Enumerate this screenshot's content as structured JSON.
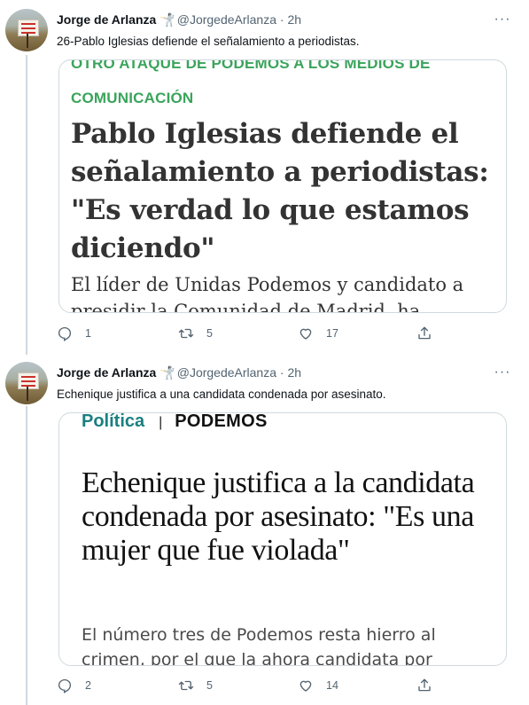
{
  "tweets": [
    {
      "author": {
        "name": "Jorge de Arlanza",
        "badge": "🤺",
        "handle": "@JorgedeArlanza",
        "time": "2h",
        "avatar_sign_text": "PROHIBIDO EL PASO A TODA PERSONA AJENA"
      },
      "text": "26-Pablo Iglesias defiende el señalamiento a periodistas.",
      "card": {
        "kicker_line1": "OTRO ATAQUE DE PODEMOS A LOS MEDIOS DE",
        "kicker_line2": "COMUNICACIÓN",
        "headline": "Pablo Iglesias defiende el señalamiento a periodistas: \"Es verdad lo que estamos diciendo\"",
        "lead_line1": "El líder de Unidas Podemos y candidato a",
        "lead_line2": "presidir la Comunidad de Madrid, ha"
      },
      "stats": {
        "replies": "1",
        "retweets": "5",
        "likes": "17"
      }
    },
    {
      "author": {
        "name": "Jorge de Arlanza",
        "badge": "🤺",
        "handle": "@JorgedeArlanza",
        "time": "2h",
        "avatar_sign_text": "PROHIBIDO EL PASO A TODA PERSONA AJENA"
      },
      "text": "Echenique justifica a una candidata condenada por asesinato.",
      "card": {
        "section": "Política",
        "separator": "|",
        "tag": "PODEMOS",
        "headline": "Echenique justifica a la candidata condenada por asesinato: \"Es una mujer que fue violada\"",
        "lead_line1": "El número tres de Podemos resta hierro al",
        "lead_line2": "crimen, por el que la ahora candidata por"
      },
      "stats": {
        "replies": "2",
        "retweets": "5",
        "likes": "14"
      }
    }
  ],
  "ui": {
    "more_glyph": "···",
    "dot": "·"
  },
  "colors": {
    "kicker_green": "#3aa45b",
    "section_teal": "#1a7f80",
    "meta_gray": "#536471",
    "border": "#cfd9de"
  }
}
